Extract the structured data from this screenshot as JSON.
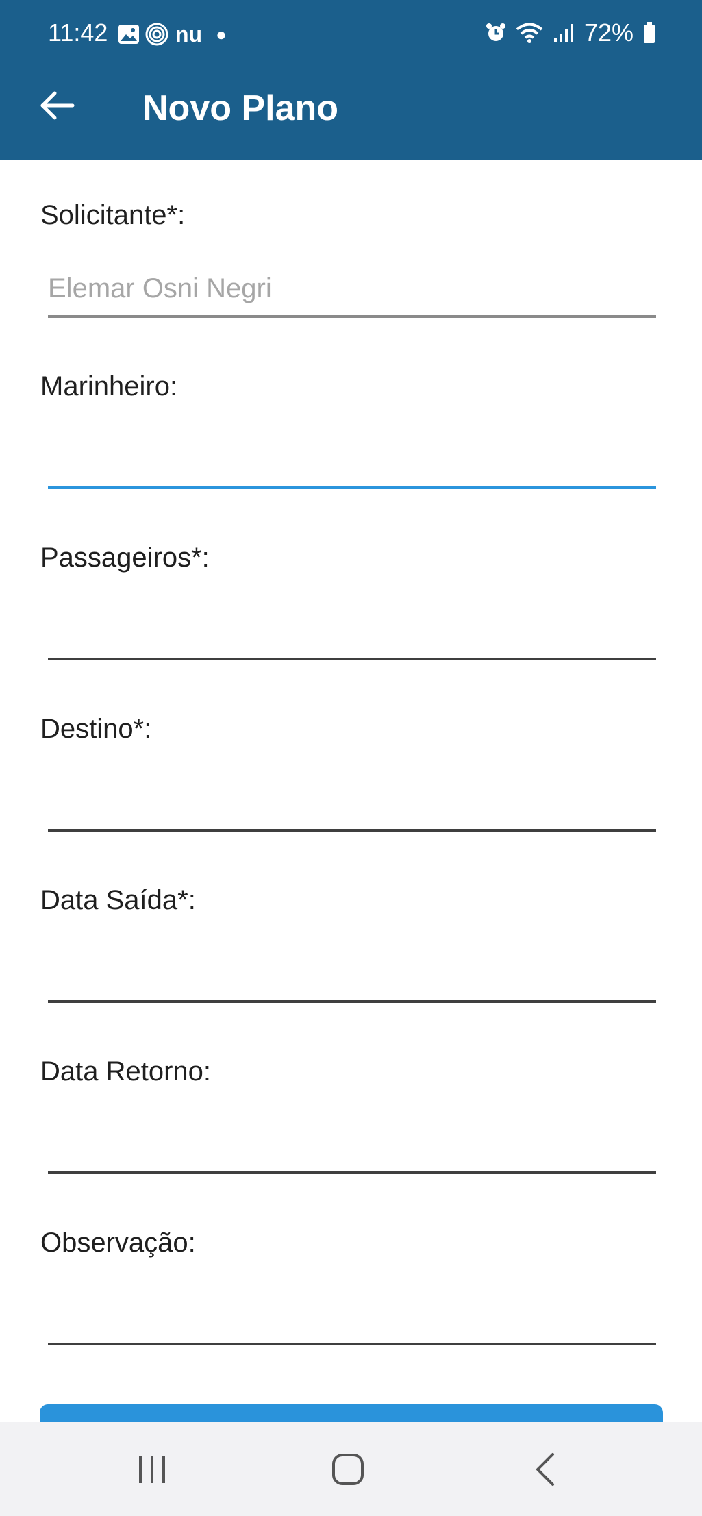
{
  "status_bar": {
    "time": "11:42",
    "carrier_text": "nu",
    "battery_percent": "72%",
    "icons_left": [
      "gallery-icon",
      "fingerprint-icon",
      "notification-dot-icon"
    ],
    "icons_right": [
      "alarm-icon",
      "wifi-icon",
      "signal-icon",
      "battery-icon"
    ]
  },
  "app_bar": {
    "title": "Novo Plano",
    "back_icon": "arrow-left-icon",
    "background_color": "#1b5f8c"
  },
  "form": {
    "fields": [
      {
        "label": "Solicitante*:",
        "placeholder": "Elemar Osni Negri",
        "state": "disabled"
      },
      {
        "label": "Marinheiro:",
        "placeholder": "",
        "state": "focused"
      },
      {
        "label": "Passageiros*:",
        "placeholder": "",
        "state": "normal"
      },
      {
        "label": "Destino*:",
        "placeholder": "",
        "state": "normal"
      },
      {
        "label": "Data Saída*:",
        "placeholder": "",
        "state": "normal"
      },
      {
        "label": "Data Retorno:",
        "placeholder": "",
        "state": "normal"
      },
      {
        "label": "Observação:",
        "placeholder": "",
        "state": "normal"
      }
    ],
    "accent_color": "#2b95dd",
    "submit_button_color": "#2a93db"
  },
  "nav_bar": {
    "buttons": [
      "recent-apps-icon",
      "home-icon",
      "back-chevron-icon"
    ]
  }
}
